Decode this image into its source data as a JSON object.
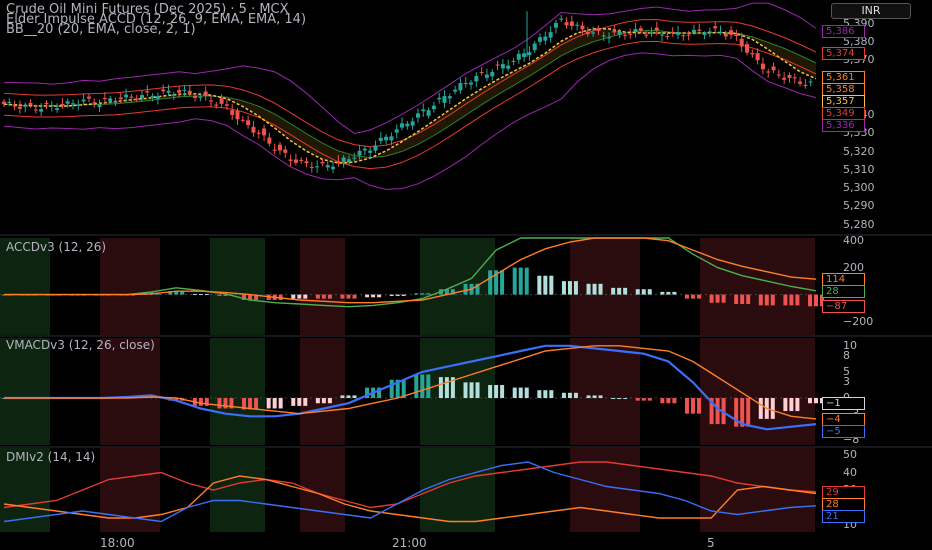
{
  "currency_label": "INR",
  "x_ticks": [
    "18:00",
    "21:00",
    "5"
  ],
  "colors": {
    "bull": "#26a69a",
    "bear": "#ef5350",
    "bull_light": "#b2dfdb",
    "bear_light": "#ffcdd2",
    "green_line": "#4caf50",
    "orange_line": "#ff7f27",
    "blue_line": "#3a6ff7",
    "purple_band": "#9c27b0",
    "red_line": "#e53935",
    "ema_yellow": "#f5c542",
    "bg_green": "#0d2410",
    "bg_red": "#2a0c0f"
  },
  "chart_data": [
    {
      "type": "candlestick",
      "title": "Crude Oil Mini Futures (Dec 2025) · 5 · MCX",
      "indicator_lines": [
        "Elder Impulse ACCD (12, 26, 9, EMA, EMA, 14)",
        "BB__20 (20, EMA, close, 2, 1)"
      ],
      "y_ticks": [
        5390,
        5380,
        5370,
        5340,
        5330,
        5320,
        5310,
        5300,
        5290,
        5280
      ],
      "y_tick_labels": [
        "5,390",
        "5,380",
        "5,370",
        "5,340",
        "5,330",
        "5,320",
        "5,310",
        "5,300",
        "5,290",
        "5,280"
      ],
      "ylim": [
        5276,
        5402
      ],
      "close_path": [
        5346,
        5345,
        5344,
        5345,
        5346,
        5348,
        5347,
        5349,
        5350,
        5351,
        5352,
        5353,
        5351,
        5348,
        5344,
        5336,
        5330,
        5322,
        5316,
        5313,
        5312,
        5314,
        5318,
        5322,
        5328,
        5334,
        5340,
        5346,
        5352,
        5358,
        5362,
        5366,
        5370,
        5376,
        5384,
        5392,
        5388,
        5385,
        5384,
        5385,
        5386,
        5385,
        5384,
        5385,
        5386,
        5386,
        5382,
        5372,
        5364,
        5361,
        5358,
        5357
      ],
      "price_tags": [
        {
          "label": "5,386",
          "value": 5386,
          "color": "#9c27b0"
        },
        {
          "label": "5,374",
          "value": 5374,
          "color": "#e53935"
        },
        {
          "label": "5,361",
          "value": 5361,
          "color": "#ff7f27"
        },
        {
          "label": "5,358",
          "value": 5358,
          "color": "#ff7f27"
        },
        {
          "label": "5,357",
          "value": 5357,
          "color": "#f5c542"
        },
        {
          "label": "5,349",
          "value": 5349,
          "color": "#e53935"
        },
        {
          "label": "5,336",
          "value": 5336,
          "color": "#9c27b0"
        }
      ]
    },
    {
      "type": "bar",
      "title": "ACCDv3 (12, 26)",
      "y_ticks": [
        400,
        200,
        0,
        -200
      ],
      "y_tick_labels": [
        "400",
        "200",
        "0",
        "−200"
      ],
      "ylim": [
        -300,
        420
      ],
      "series": [
        {
          "color": "#4caf50",
          "values": [
            0,
            0,
            0,
            0,
            0,
            0,
            20,
            50,
            30,
            5,
            -40,
            -60,
            -70,
            -80,
            -90,
            -80,
            -60,
            -30,
            40,
            120,
            330,
            460,
            480,
            490,
            500,
            480,
            460,
            420,
            300,
            200,
            140,
            100,
            60,
            28
          ]
        },
        {
          "color": "#ff7f27",
          "values": [
            0,
            0,
            0,
            0,
            0,
            0,
            5,
            25,
            25,
            15,
            0,
            -20,
            -40,
            -50,
            -60,
            -60,
            -50,
            -40,
            0,
            40,
            150,
            260,
            340,
            390,
            420,
            430,
            420,
            400,
            330,
            260,
            210,
            170,
            130,
            114
          ]
        }
      ],
      "histogram": [
        0,
        0,
        0,
        0,
        0,
        0,
        15,
        25,
        5,
        -10,
        -40,
        -40,
        -30,
        -30,
        -30,
        -20,
        -10,
        10,
        40,
        80,
        180,
        200,
        140,
        100,
        80,
        50,
        40,
        20,
        -30,
        -60,
        -70,
        -80,
        -80,
        -87
      ],
      "value_tags": [
        {
          "label": "114",
          "value": 114,
          "color": "#ff7f27"
        },
        {
          "label": "28",
          "value": 28,
          "color": "#4caf50"
        },
        {
          "label": "−87",
          "value": -87,
          "color": "#ef5350"
        }
      ]
    },
    {
      "type": "bar",
      "title": "VMACDv3 (12, 26, close)",
      "y_ticks": [
        10,
        8,
        5,
        3,
        0,
        -3,
        -5,
        -8
      ],
      "y_tick_labels": [
        "10",
        "8",
        "5",
        "3",
        "0",
        "−3",
        "−5",
        "−8"
      ],
      "ylim": [
        -9,
        11.5
      ],
      "series": [
        {
          "color": "#3a6ff7",
          "values": [
            0,
            0,
            0,
            0,
            0,
            0.2,
            0.5,
            -0.5,
            -2,
            -3,
            -3.5,
            -3.5,
            -3,
            -2,
            -1,
            1,
            3,
            5,
            6,
            7,
            8,
            9,
            10,
            10,
            9.5,
            9,
            8.5,
            7,
            3,
            -2,
            -5,
            -6,
            -5.5,
            -5
          ]
        },
        {
          "color": "#ff7f27",
          "values": [
            0,
            0,
            0,
            0,
            0,
            0,
            0.2,
            0,
            -1,
            -1.5,
            -2,
            -2.5,
            -3,
            -2.5,
            -2,
            -1,
            0,
            1.5,
            3,
            4.5,
            6,
            7.5,
            9,
            9.5,
            10,
            10,
            9.5,
            9,
            7,
            4,
            1,
            -2,
            -3.5,
            -4
          ]
        }
      ],
      "histogram": [
        0,
        0,
        0,
        0,
        0,
        0.2,
        0.4,
        -0.5,
        -1.5,
        -2,
        -2.2,
        -2,
        -1.5,
        -1,
        0.5,
        2,
        3.5,
        4.5,
        4,
        3,
        2.5,
        2,
        1.5,
        1,
        0.5,
        0,
        -0.5,
        -1,
        -3,
        -5,
        -5.5,
        -4,
        -2.5,
        -1
      ],
      "value_tags": [
        {
          "label": "−1",
          "value": -1,
          "color": "#d1d4dc"
        },
        {
          "label": "−4",
          "value": -4,
          "color": "#ff7f27"
        },
        {
          "label": "−5",
          "value": -5,
          "color": "#3a6ff7"
        }
      ]
    },
    {
      "type": "line",
      "title": "DMIv2 (14, 14)",
      "y_ticks": [
        50,
        40,
        30,
        20,
        10
      ],
      "y_tick_labels": [
        "50",
        "40",
        "30",
        "20",
        "10"
      ],
      "ylim": [
        6,
        54
      ],
      "series": [
        {
          "color": "#e53935",
          "values": [
            20,
            22,
            24,
            30,
            36,
            38,
            40,
            34,
            30,
            34,
            36,
            34,
            28,
            24,
            20,
            22,
            28,
            34,
            38,
            40,
            42,
            44,
            46,
            46,
            44,
            42,
            40,
            38,
            34,
            32,
            30,
            29
          ]
        },
        {
          "color": "#ff7f27",
          "values": [
            22,
            20,
            18,
            16,
            14,
            14,
            16,
            20,
            34,
            38,
            36,
            32,
            28,
            22,
            18,
            16,
            14,
            12,
            12,
            14,
            16,
            18,
            20,
            18,
            16,
            14,
            14,
            14,
            30,
            32,
            30,
            28
          ]
        },
        {
          "color": "#3a6ff7",
          "values": [
            12,
            14,
            16,
            18,
            16,
            14,
            12,
            20,
            24,
            24,
            22,
            20,
            18,
            16,
            14,
            22,
            30,
            36,
            40,
            44,
            46,
            40,
            36,
            32,
            30,
            28,
            24,
            18,
            16,
            18,
            20,
            21
          ]
        }
      ],
      "value_tags": [
        {
          "label": "29",
          "value": 29,
          "color": "#e53935"
        },
        {
          "label": "28",
          "value": 28,
          "color": "#ff7f27"
        },
        {
          "label": "21",
          "value": 21,
          "color": "#3a6ff7"
        }
      ]
    }
  ]
}
